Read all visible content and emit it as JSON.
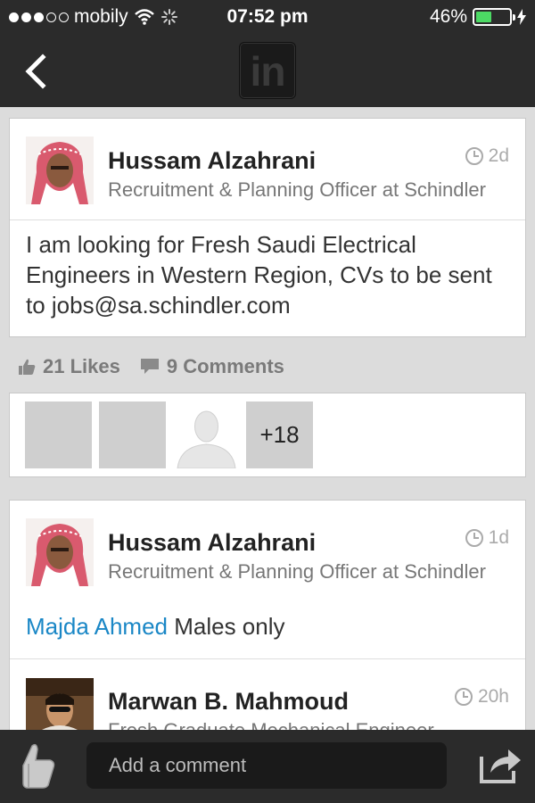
{
  "status_bar": {
    "carrier": "mobily",
    "time": "07:52 pm",
    "battery": "46%",
    "battery_level": 0.46,
    "signal_bars": 3,
    "signal_total": 5
  },
  "nav": {
    "logo_text": "in",
    "back_icon": "chevron-left-icon"
  },
  "post": {
    "author": "Hussam Alzahrani",
    "headline": "Recruitment & Planning Officer at Schindler",
    "time_ago": "2d",
    "body": "I am looking for Fresh Saudi Electrical Engineers in Western Region, CVs to be sent to jobs@sa.schindler.com"
  },
  "stats": {
    "likes": "21 Likes",
    "comments": "9 Comments"
  },
  "likers": {
    "more_count": "+18"
  },
  "comments": [
    {
      "author": "Hussam Alzahrani",
      "headline": "Recruitment & Planning Officer at Schindler",
      "time_ago": "1d",
      "mention": "Majda Ahmed",
      "text": "Males only"
    },
    {
      "author": "Marwan B. Mahmoud",
      "headline": "Fresh Graduate Mechanical Engineer",
      "time_ago": "20h"
    }
  ],
  "bottom_bar": {
    "comment_placeholder": "Add a comment"
  },
  "colors": {
    "bar_bg": "#2b2b2b",
    "link": "#1a87c6",
    "battery": "#4cd964",
    "page_bg": "#dcdcdc"
  }
}
